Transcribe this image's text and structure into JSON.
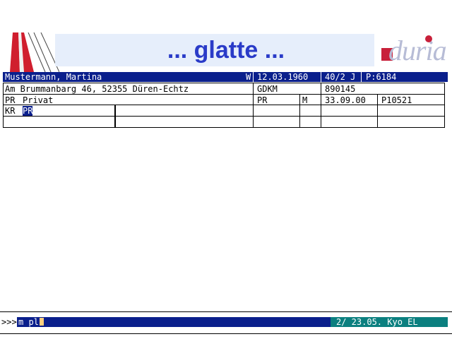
{
  "banner": {
    "title": "... glatte ...",
    "logo_text": "duria"
  },
  "patient_header": {
    "name": "Mustermann, Martina",
    "flag": "W",
    "birth_date": "12.03.1960",
    "age_code": "40/2 J",
    "patient_no": "P:6184"
  },
  "address_row": {
    "address": "Am Brummanbarg 46, 52355 Düren-Echtz",
    "insurance": "GDKM",
    "insurance_no": "890145"
  },
  "status_row": {
    "type_code": "PR",
    "type_label": "Privat",
    "kind": "PR",
    "sex": "M",
    "date": "33.09.00",
    "ref": "P10521"
  },
  "entry_row": {
    "code": "KR",
    "value": "PR"
  },
  "command_line": {
    "prompt": ">>>",
    "input": "m pl",
    "status": "2/ 23.05. Kyo EL"
  },
  "colors": {
    "header_bg": "#0a1f8c",
    "status_bg": "#0b7f7f",
    "title": "#2a3bc8"
  }
}
